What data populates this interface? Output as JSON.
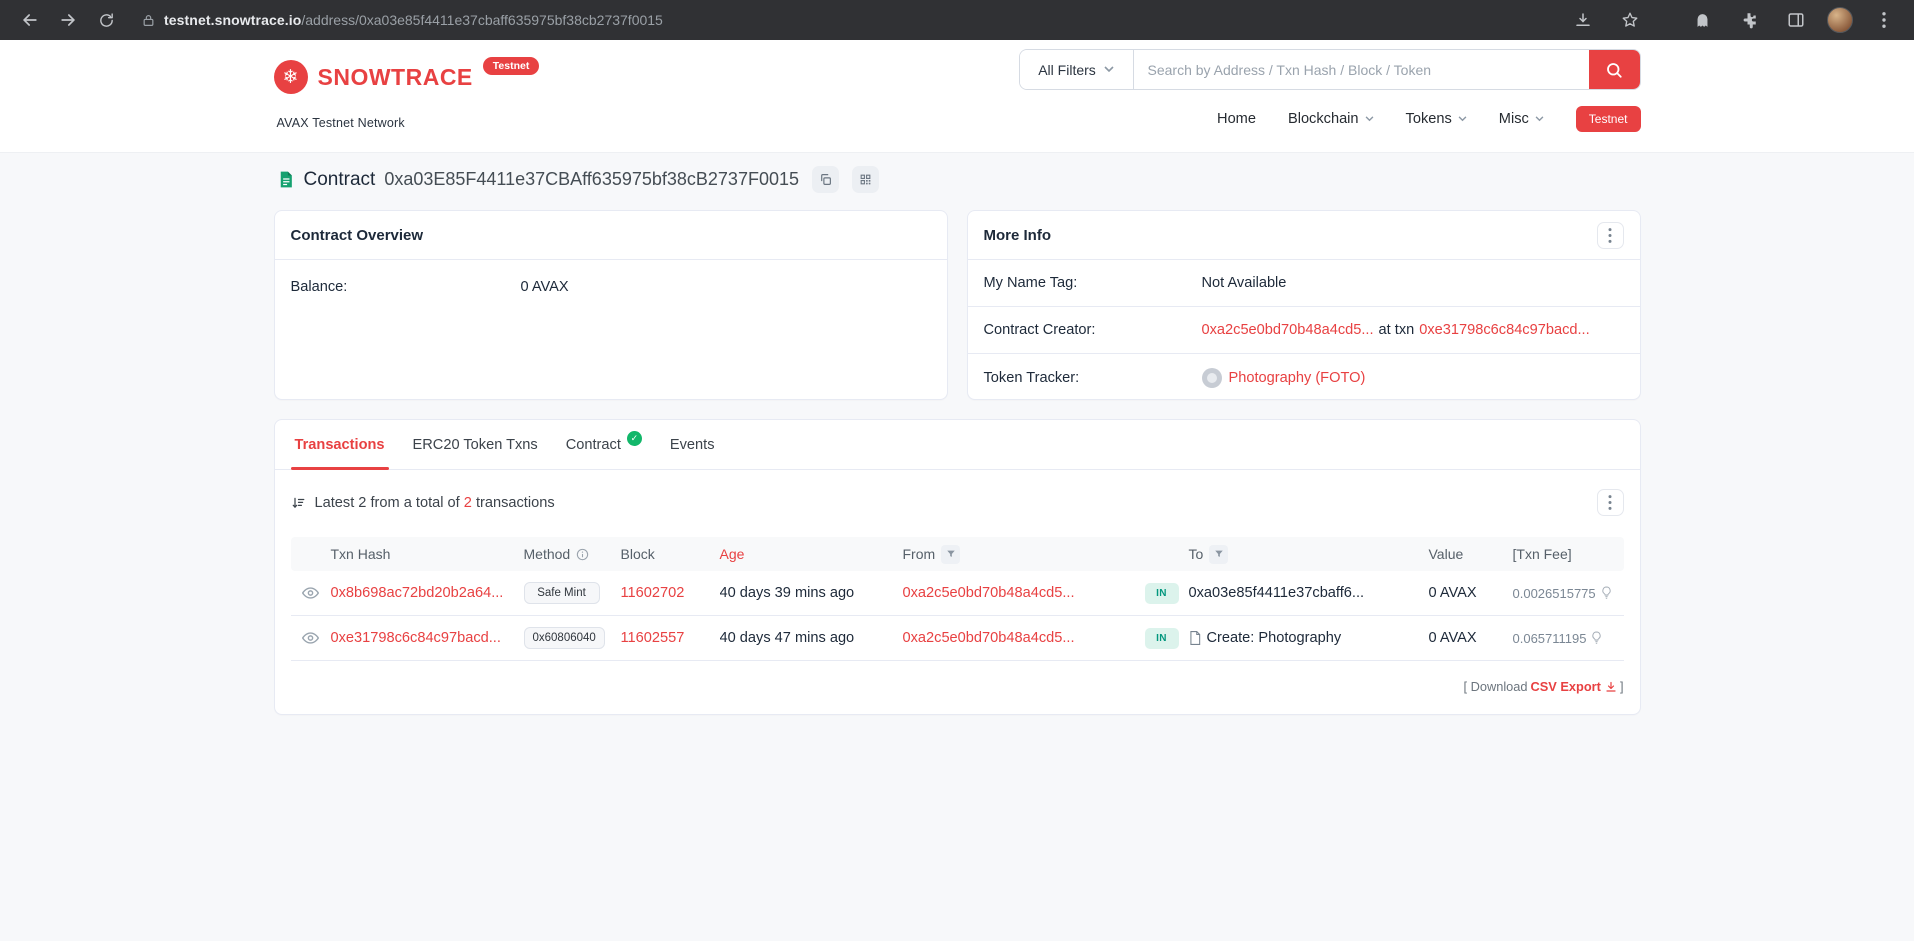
{
  "browser": {
    "url_domain": "testnet.snowtrace.io",
    "url_path": "/address/0xa03e85f4411e37cbaff635975bf38cb2737f0015"
  },
  "header": {
    "brand": "SNOWTRACE",
    "brand_badge": "Testnet",
    "network_label": "AVAX Testnet Network",
    "search": {
      "filter_label": "All Filters",
      "placeholder": "Search by Address / Txn Hash / Block / Token"
    },
    "nav": {
      "home": "Home",
      "blockchain": "Blockchain",
      "tokens": "Tokens",
      "misc": "Misc",
      "testnet": "Testnet"
    }
  },
  "icons": {
    "snowflake": "❄",
    "check": "✓"
  },
  "page": {
    "title": "Contract",
    "address": "0xa03E85F4411e37CBAff635975bf38cB2737F0015"
  },
  "overview": {
    "title": "Contract Overview",
    "balance_label": "Balance:",
    "balance_value": "0 AVAX"
  },
  "more_info": {
    "title": "More Info",
    "name_tag_label": "My Name Tag:",
    "name_tag_value": "Not Available",
    "creator_label": "Contract Creator:",
    "creator_address": "0xa2c5e0bd70b48a4cd5...",
    "creator_connector": "at txn",
    "creator_txn": "0xe31798c6c84c97bacd...",
    "tracker_label": "Token Tracker:",
    "tracker_value": "Photography (FOTO)"
  },
  "tabs": {
    "transactions": "Transactions",
    "erc20": "ERC20 Token Txns",
    "contract": "Contract",
    "events": "Events"
  },
  "transactions": {
    "summary_prefix": "Latest 2 from a total of ",
    "summary_count": "2",
    "summary_suffix": " transactions",
    "columns": {
      "txn_hash": "Txn Hash",
      "method": "Method",
      "block": "Block",
      "age": "Age",
      "from": "From",
      "to": "To",
      "value": "Value",
      "txn_fee": "[Txn Fee]"
    },
    "rows": [
      {
        "hash": "0x8b698ac72bd20b2a64...",
        "method": "Safe Mint",
        "block": "11602702",
        "age": "40 days 39 mins ago",
        "from": "0xa2c5e0bd70b48a4cd5...",
        "direction": "IN",
        "to": "0xa03e85f4411e37cbaff6...",
        "value": "0 AVAX",
        "fee": "0.0026515775"
      },
      {
        "hash": "0xe31798c6c84c97bacd...",
        "method": "0x60806040",
        "block": "11602557",
        "age": "40 days 47 mins ago",
        "from": "0xa2c5e0bd70b48a4cd5...",
        "direction": "IN",
        "to": "Create: Photography",
        "value": "0 AVAX",
        "fee": "0.065711195"
      }
    ],
    "download_prefix": "[ Download",
    "download_link": "CSV Export",
    "download_suffix": "]"
  },
  "colors": {
    "accent": "#e84142",
    "in_badge_bg": "#dcf3ec",
    "in_badge_text": "#02977e"
  }
}
